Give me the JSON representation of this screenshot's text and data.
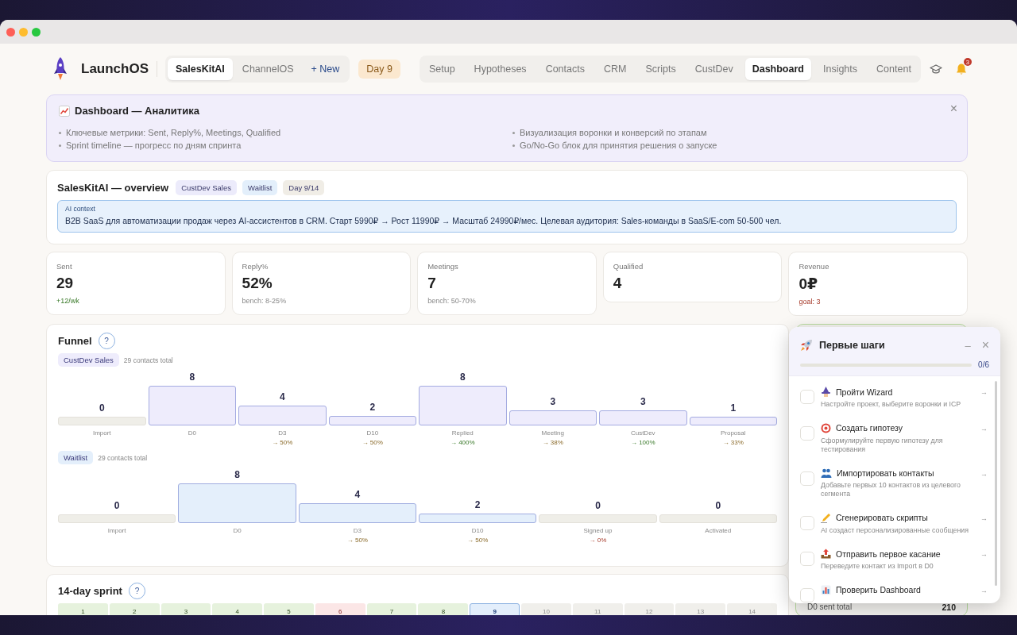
{
  "header": {
    "brand": "LaunchOS",
    "projects": [
      {
        "label": "SalesKitAI",
        "selected": true
      },
      {
        "label": "ChannelOS",
        "selected": false
      }
    ],
    "new_project": "+ New",
    "day_badge": "Day 9",
    "nav": [
      {
        "label": "Setup",
        "selected": false
      },
      {
        "label": "Hypotheses",
        "selected": false
      },
      {
        "label": "Contacts",
        "selected": false
      },
      {
        "label": "CRM",
        "selected": false
      },
      {
        "label": "Scripts",
        "selected": false
      },
      {
        "label": "CustDev",
        "selected": false
      },
      {
        "label": "Dashboard",
        "selected": true
      },
      {
        "label": "Insights",
        "selected": false
      },
      {
        "label": "Content",
        "selected": false
      }
    ],
    "notifications": "3"
  },
  "banner": {
    "title": "Dashboard — Аналитика",
    "close": "×",
    "bullets": [
      "Ключевые метрики: Sent, Reply%, Meetings, Qualified",
      "Визуализация воронки и конверсий по этапам",
      "Sprint timeline — прогресс по дням спринта",
      "Go/No-Go блок для принятия решения о запуске"
    ]
  },
  "overview": {
    "title": "SalesKitAI — overview",
    "tags": [
      {
        "label": "CustDev Sales",
        "color": "#ecebfb"
      },
      {
        "label": "Waitlist",
        "color": "#e3effb"
      },
      {
        "label": "Day 9/14",
        "color": "#f0ede6"
      }
    ],
    "context_label": "AI context",
    "context_text": "B2B SaaS для автоматизации продаж через AI-ассистентов в CRM. Старт 5990₽ → Рост 11990₽ → Масштаб 24990₽/мес. Целевая аудитория: Sales-команды в SaaS/E-com 50-500 чел."
  },
  "metrics": [
    {
      "label": "Sent",
      "value": "29",
      "note": "+12/wk",
      "kind": "good"
    },
    {
      "label": "Reply%",
      "value": "52%",
      "note": "bench: 8-25%",
      "kind": "neutral"
    },
    {
      "label": "Meetings",
      "value": "7",
      "note": "bench: 50-70%",
      "kind": "neutral"
    },
    {
      "label": "Qualified",
      "value": "4"
    },
    {
      "label": "Revenue",
      "value": "0₽",
      "note": "goal: 3",
      "kind": "bad"
    }
  ],
  "funnel": {
    "title": "Funnel",
    "help": "?",
    "funnels": [
      {
        "name": "CustDev Sales",
        "color": "#eeecfc",
        "total": "29 contacts total",
        "stages": [
          {
            "value": "0",
            "label": "Import"
          },
          {
            "value": "8",
            "label": "D0"
          },
          {
            "value": "4",
            "label": "D3",
            "conversion": "→ 50%",
            "kind": "neutral"
          },
          {
            "value": "2",
            "label": "D10",
            "conversion": "→ 50%",
            "kind": "neutral"
          },
          {
            "value": "8",
            "label": "Replied",
            "conversion": "→ 400%",
            "kind": "good"
          },
          {
            "value": "3",
            "label": "Meeting",
            "conversion": "→ 38%",
            "kind": "neutral"
          },
          {
            "value": "3",
            "label": "CustDev",
            "conversion": "→ 100%",
            "kind": "good"
          },
          {
            "value": "1",
            "label": "Proposal",
            "conversion": "→ 33%",
            "kind": "neutral"
          }
        ]
      },
      {
        "name": "Waitlist",
        "color": "#e4effb",
        "total": "29 contacts total",
        "stages": [
          {
            "value": "0",
            "label": "Import"
          },
          {
            "value": "8",
            "label": "D0"
          },
          {
            "value": "4",
            "label": "D3",
            "conversion": "→ 50%",
            "kind": "neutral"
          },
          {
            "value": "2",
            "label": "D10",
            "conversion": "→ 50%",
            "kind": "neutral"
          },
          {
            "value": "0",
            "label": "Signed up",
            "conversion": "→ 0%",
            "kind": "bad"
          },
          {
            "value": "0",
            "label": "Activated"
          }
        ]
      }
    ]
  },
  "sprint": {
    "title": "14-day sprint",
    "help": "?",
    "days": [
      {
        "label": "1",
        "kind": "done"
      },
      {
        "label": "2",
        "kind": "done"
      },
      {
        "label": "3",
        "kind": "done"
      },
      {
        "label": "4",
        "kind": "done"
      },
      {
        "label": "5",
        "kind": "done"
      },
      {
        "label": "6",
        "kind": "missed"
      },
      {
        "label": "7",
        "kind": "done"
      },
      {
        "label": "8",
        "kind": "done"
      },
      {
        "label": "9",
        "kind": "current"
      },
      {
        "label": "10",
        "kind": "future"
      },
      {
        "label": "11",
        "kind": "future"
      },
      {
        "label": "12",
        "kind": "future"
      },
      {
        "label": "13",
        "kind": "future"
      },
      {
        "label": "14",
        "kind": "future"
      }
    ]
  },
  "side_card": {
    "rows": [
      {
        "label": "D0 sent total",
        "value": "210"
      }
    ]
  },
  "onboarding": {
    "title": "Первые шаги",
    "minimize": "–",
    "close": "×",
    "level": 0,
    "progress": "0/6",
    "steps": [
      {
        "title": "Пройти Wizard",
        "description": "Настройте проект, выберите воронки и ICP",
        "checked": false,
        "arrow": "→"
      },
      {
        "title": "Создать гипотезу",
        "description": "Сформулируйте первую гипотезу для тестирования",
        "checked": false,
        "arrow": "→"
      },
      {
        "title": "Импортировать контакты",
        "description": "Добавьте первых 10 контактов из целевого сегмента",
        "checked": false,
        "arrow": "→"
      },
      {
        "title": "Сгенерировать скрипты",
        "description": "AI создаст персонализированные сообщения",
        "checked": false,
        "arrow": "→"
      },
      {
        "title": "Отправить первое касание",
        "description": "Переведите контакт из Import в D0",
        "checked": false,
        "arrow": "→"
      },
      {
        "title": "Проверить Dashboard",
        "checked": false,
        "arrow": "→"
      }
    ]
  }
}
